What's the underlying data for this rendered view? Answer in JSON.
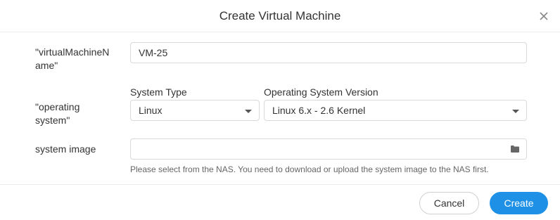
{
  "dialog": {
    "title": "Create Virtual Machine"
  },
  "form": {
    "vm_name": {
      "label_line1": "\"virtualMachineN",
      "label_line2": "ame\"",
      "value": "VM-25"
    },
    "os": {
      "label_line1": "\"operating",
      "label_line2": "system\"",
      "system_type_label": "System Type",
      "system_type_value": "Linux",
      "os_version_label": "Operating System Version",
      "os_version_value": "Linux 6.x - 2.6 Kernel"
    },
    "system_image": {
      "label": "system image",
      "value": "",
      "hint": "Please select from the NAS. You need to download or upload the system image to the NAS first."
    }
  },
  "footer": {
    "cancel_label": "Cancel",
    "create_label": "Create"
  },
  "colors": {
    "primary": "#1e90e6",
    "border": "#d9d9d9",
    "text": "#333333",
    "hint": "#666666"
  },
  "icons": {
    "close": "close-icon",
    "dropdown": "caret-down-icon",
    "browse": "folder-icon"
  }
}
